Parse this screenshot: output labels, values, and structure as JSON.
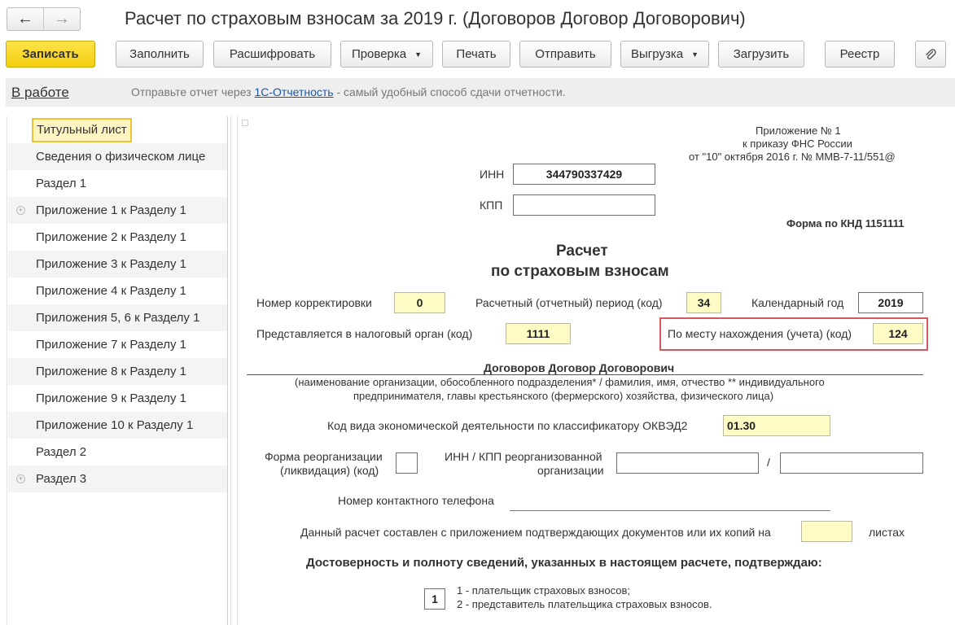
{
  "window": {
    "title": "Расчет по страховым взносам за 2019 г. (Договоров Договор Договорович)",
    "back_icon": "←",
    "forward_icon": "→"
  },
  "toolbar": {
    "save": "Записать",
    "fill": "Заполнить",
    "decode": "Расшифровать",
    "check": "Проверка",
    "print": "Печать",
    "send": "Отправить",
    "export": "Выгрузка",
    "load": "Загрузить",
    "registry": "Реестр",
    "caret": "▼"
  },
  "status": {
    "state": "В работе",
    "msg_before": "Отправьте отчет через ",
    "msg_link": "1С-Отчетность",
    "msg_after": " - самый удобный способ сдачи отчетности."
  },
  "sidebar": {
    "items": [
      {
        "label": "Титульный лист"
      },
      {
        "label": "Сведения о физическом лице"
      },
      {
        "label": "Раздел 1"
      },
      {
        "label": "Приложение 1 к Разделу 1"
      },
      {
        "label": "Приложение 2 к Разделу 1"
      },
      {
        "label": "Приложение 3 к Разделу 1"
      },
      {
        "label": "Приложение 4 к Разделу 1"
      },
      {
        "label": "Приложения 5, 6 к Разделу 1"
      },
      {
        "label": "Приложение 7 к Разделу 1"
      },
      {
        "label": "Приложение 8 к Разделу 1"
      },
      {
        "label": "Приложение 9 к Разделу 1"
      },
      {
        "label": "Приложение 10 к Разделу 1"
      },
      {
        "label": "Раздел 2"
      },
      {
        "label": "Раздел 3"
      }
    ],
    "expand_glyph": "+"
  },
  "form": {
    "appendix_line1": "Приложение № 1",
    "appendix_line2": "к приказу ФНС России",
    "appendix_line3": "от \"10\" октября 2016 г. № ММВ-7-11/551@",
    "inn_label": "ИНН",
    "inn_value": "344790337429",
    "kpp_label": "КПП",
    "kpp_value": "",
    "knd": "Форма по КНД 1151111",
    "heading1": "Расчет",
    "heading2": "по страховым взносам",
    "correction_label": "Номер корректировки",
    "correction_value": "0",
    "period_label": "Расчетный (отчетный) период (код)",
    "period_value": "34",
    "year_label": "Календарный год",
    "year_value": "2019",
    "tax_authority_label": "Представляется в налоговый орган (код)",
    "tax_authority_value": "1111",
    "location_label": "По месту нахождения (учета) (код)",
    "location_value": "124",
    "org_name": "Договоров Договор Договорович",
    "org_caption1": "(наименование организации, обособленного подразделения* / фамилия, имя, отчество ** индивидуального",
    "org_caption2": "предпринимателя, главы крестьянского (фермерского) хозяйства, физического лица)",
    "okved_label": "Код вида экономической деятельности по классификатору ОКВЭД2",
    "okved_value": "01.30",
    "reorg_label1": "Форма реорганизации",
    "reorg_label2": "(ликвидация) (код)",
    "reorg_inn_label1": "ИНН / КПП реорганизованной",
    "reorg_inn_label2": "организации",
    "slash": "/",
    "phone_label": "Номер контактного телефона",
    "pages_label": "Данный расчет составлен с приложением подтверждающих документов или их копий на",
    "pages_suffix": "листах",
    "confirm_heading": "Достоверность и полноту сведений, указанных в настоящем расчете, подтверждаю:",
    "signer_value": "1",
    "signer_opt1": "1 - плательщик страховых взносов;",
    "signer_opt2": "2 - представитель плательщика страховых взносов."
  }
}
